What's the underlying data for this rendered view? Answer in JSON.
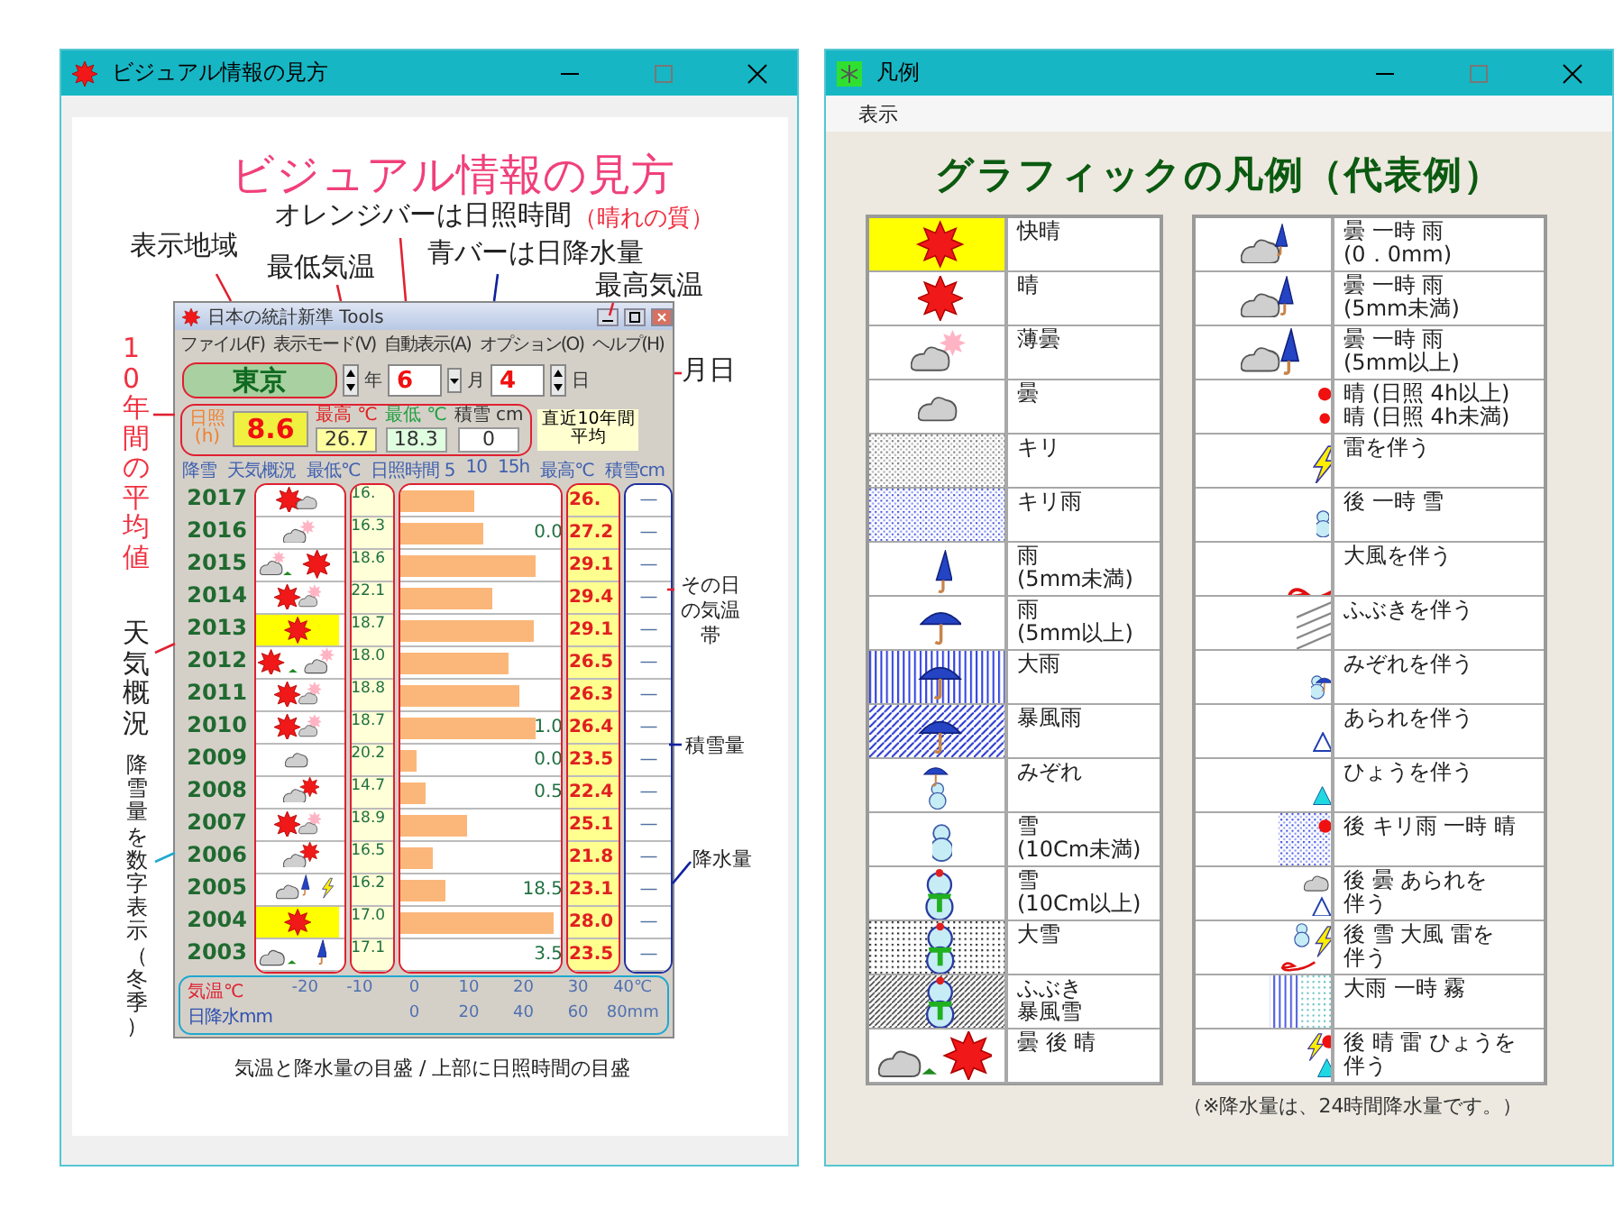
{
  "guide_window": {
    "title": "ビジュアル情報の見方",
    "heading": "ビジュアル情報の見方",
    "annotations": [
      {
        "text": "オレンジバーは日照時間",
        "kind": "note"
      },
      {
        "text": "（晴れの質）",
        "kind": "accent"
      },
      {
        "text": "表示地域",
        "kind": "note"
      },
      {
        "text": "青バーは日降水量",
        "kind": "note"
      },
      {
        "text": "最低気温",
        "kind": "note"
      },
      {
        "text": "最高気温",
        "kind": "note"
      },
      {
        "text": "月日",
        "kind": "note"
      },
      {
        "text": "10年間の平均値",
        "kind": "vertical_accent"
      },
      {
        "text": "天気概況",
        "kind": "vertical"
      },
      {
        "text": "降雪量を数字表示（冬季）",
        "kind": "vertical_small"
      },
      {
        "text": "その日の気温帯",
        "kind": "small"
      },
      {
        "text": "積雪量",
        "kind": "small"
      },
      {
        "text": "降水量",
        "kind": "small"
      },
      {
        "text": "気温と降水量の目盛 / 上部に日照時間の目盛",
        "kind": "small"
      }
    ],
    "app": {
      "title": "日本の統計新準 Tools",
      "menu": [
        "ファイル(F)",
        "表示モード(V)",
        "自動表示(A)",
        "オプション(O)",
        "ヘルプ(H)"
      ],
      "location": "東京",
      "year_label": "年",
      "month": "6",
      "month_label": "月",
      "day": "4",
      "day_label": "日",
      "stats": [
        {
          "kind": "sun",
          "label": "日照\n(h)",
          "value": "8.6"
        },
        {
          "kind": "max",
          "label": "最高 ℃",
          "value": "26.7"
        },
        {
          "kind": "min",
          "label": "最低 ℃",
          "value": "18.3"
        },
        {
          "kind": "snow",
          "label": "積雪 cm",
          "value": "0"
        }
      ],
      "average_lines": [
        "直近10年間",
        "平均"
      ],
      "header": [
        "降雪",
        "天気概況",
        "最低℃",
        "日照時間 5",
        "10",
        "15h",
        "最高℃",
        "積雪cm"
      ],
      "rows": [
        {
          "year": "2017",
          "kind": "sun_cloud",
          "min": "16.",
          "level": 0.45,
          "precip": "",
          "max": "26.",
          "snow": "—"
        },
        {
          "year": "2016",
          "kind": "thin_cloud",
          "min": "16.3",
          "level": 0.5,
          "precip": "0.0",
          "max": "27.2",
          "snow": "—"
        },
        {
          "year": "2015",
          "kind": "cloud_then_sun",
          "min": "18.6",
          "level": 0.82,
          "precip": "",
          "max": "29.1",
          "snow": "—"
        },
        {
          "year": "2014",
          "kind": "sun_thin",
          "min": "22.1",
          "level": 0.55,
          "precip": "",
          "max": "29.4",
          "snow": "—"
        },
        {
          "year": "2013",
          "kind": "clear",
          "min": "18.7",
          "level": 0.8,
          "precip": "",
          "max": "29.1",
          "snow": "—"
        },
        {
          "year": "2012",
          "kind": "sun_then_thin",
          "min": "18.0",
          "level": 0.65,
          "precip": "",
          "max": "26.5",
          "snow": "—"
        },
        {
          "year": "2011",
          "kind": "sun_thin",
          "min": "18.8",
          "level": 0.72,
          "precip": "",
          "max": "26.3",
          "snow": "—"
        },
        {
          "year": "2010",
          "kind": "sun_thin",
          "min": "18.7",
          "level": 0.82,
          "precip": "1.0",
          "max": "26.4",
          "snow": "—"
        },
        {
          "year": "2009",
          "kind": "cloudy",
          "min": "20.2",
          "level": 0.1,
          "precip": "0.0",
          "max": "23.5",
          "snow": "—"
        },
        {
          "year": "2008",
          "kind": "cloud_sun",
          "min": "14.7",
          "level": 0.15,
          "precip": "0.5",
          "max": "22.4",
          "snow": "—"
        },
        {
          "year": "2007",
          "kind": "sun_thin",
          "min": "18.9",
          "level": 0.4,
          "precip": "",
          "max": "25.1",
          "snow": "—"
        },
        {
          "year": "2006",
          "kind": "cloud_sun",
          "min": "16.5",
          "level": 0.2,
          "precip": "",
          "max": "21.8",
          "snow": "—"
        },
        {
          "year": "2005",
          "kind": "cloud_rain_thunder",
          "min": "16.2",
          "level": 0.27,
          "precip": "18.5",
          "max": "23.1",
          "snow": "—"
        },
        {
          "year": "2004",
          "kind": "clear",
          "min": "17.0",
          "level": 0.92,
          "precip": "",
          "max": "28.0",
          "snow": "—"
        },
        {
          "year": "2003",
          "kind": "cloud_then_rain",
          "min": "17.1",
          "level": 0,
          "precip": "3.5",
          "max": "23.5",
          "snow": "—"
        }
      ],
      "axis": {
        "temp_label": "気温℃",
        "temp_ticks": [
          "-20",
          "-10",
          "0",
          "10",
          "20",
          "30",
          "40℃"
        ],
        "precip_label": "日降水mm",
        "precip_ticks": [
          "0",
          "20",
          "40",
          "60",
          "80mm"
        ]
      }
    }
  },
  "legend_window": {
    "title": "凡例",
    "menu": [
      "表示"
    ],
    "heading": "グラフィックの凡例（代表例）",
    "left_table": [
      {
        "kind": "clear",
        "lines": [
          "快晴"
        ]
      },
      {
        "kind": "sunny",
        "lines": [
          "晴"
        ]
      },
      {
        "kind": "thin_cloud_l",
        "lines": [
          "薄曇"
        ]
      },
      {
        "kind": "cloudy_l",
        "lines": [
          "曇"
        ]
      },
      {
        "kind": "fog",
        "lines": [
          "キリ"
        ]
      },
      {
        "kind": "fog_rain",
        "lines": [
          "キリ雨"
        ]
      },
      {
        "kind": "rain_light",
        "lines": [
          "雨",
          "(5mm未満)"
        ]
      },
      {
        "kind": "rain_heavy",
        "lines": [
          "雨",
          "(5mm以上)"
        ]
      },
      {
        "kind": "downpour",
        "lines": [
          "大雨"
        ]
      },
      {
        "kind": "storm",
        "lines": [
          "暴風雨"
        ]
      },
      {
        "kind": "sleet",
        "lines": [
          "みぞれ"
        ]
      },
      {
        "kind": "snow_light",
        "lines": [
          "雪",
          "(10Cm未満)"
        ]
      },
      {
        "kind": "snow_heavy",
        "lines": [
          "雪",
          "(10Cm以上)"
        ]
      },
      {
        "kind": "heavy_snow",
        "lines": [
          "大雪"
        ]
      },
      {
        "kind": "blizzard",
        "lines": [
          "ふぶき",
          "暴風雪"
        ]
      },
      {
        "kind": "cloud_then_sun_l",
        "lines": [
          "曇 後 晴"
        ]
      }
    ],
    "right_table": [
      {
        "kind": "cloud_rain_trace",
        "lines": [
          "曇 一時 雨",
          "(0．0mm)"
        ]
      },
      {
        "kind": "cloud_rain_light",
        "lines": [
          "曇 一時 雨",
          "(5mm未満)"
        ]
      },
      {
        "kind": "cloud_rain_heavy",
        "lines": [
          "曇 一時 雨",
          "(5mm以上)"
        ]
      },
      {
        "kind": "sun_marks",
        "lines": [
          "晴 (日照 4h以上)",
          "晴 (日照 4h未満)"
        ]
      },
      {
        "kind": "thunder",
        "lines": [
          "雷を伴う"
        ]
      },
      {
        "kind": "then_snow",
        "lines": [
          "後 一時 雪"
        ]
      },
      {
        "kind": "wind",
        "lines": [
          "大風を伴う"
        ]
      },
      {
        "kind": "blizzard_mark",
        "lines": [
          "ふぶきを伴う"
        ]
      },
      {
        "kind": "sleet_mark",
        "lines": [
          "みぞれを伴う"
        ]
      },
      {
        "kind": "hail_outline",
        "lines": [
          "あられを伴う"
        ]
      },
      {
        "kind": "hail_filled",
        "lines": [
          "ひょうを伴う"
        ]
      },
      {
        "kind": "fog_rain_sun",
        "lines": [
          "後 キリ雨 一時 晴"
        ]
      },
      {
        "kind": "cloud_hail",
        "lines": [
          "後 曇 あられを",
          "伴う"
        ]
      },
      {
        "kind": "snow_wind_thunder",
        "lines": [
          "後 雪 大風 雷を",
          "伴う"
        ]
      },
      {
        "kind": "rain_fog",
        "lines": [
          "大雨 一時 霧"
        ]
      },
      {
        "kind": "sun_thunder_hail",
        "lines": [
          "後 晴 雷 ひょうを",
          "伴う"
        ]
      }
    ],
    "note": "（※降水量は、24時間降水量です。）"
  }
}
